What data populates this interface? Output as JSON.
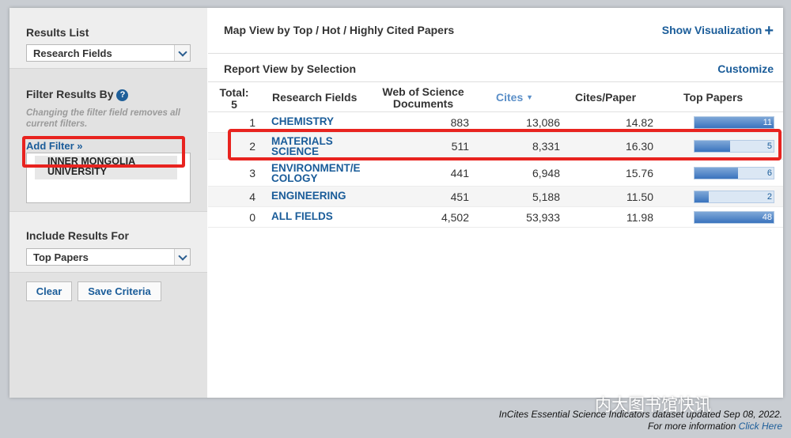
{
  "sidebar": {
    "results_list": {
      "heading": "Results List",
      "selected": "Research Fields"
    },
    "filter": {
      "heading": "Filter Results By",
      "note": "Changing the filter field removes all current filters.",
      "add_filter": "Add Filter »",
      "chip": "INNER MONGOLIA UNIVERSITY"
    },
    "include": {
      "heading": "Include Results For",
      "selected": "Top Papers"
    },
    "buttons": {
      "clear": "Clear",
      "save": "Save Criteria"
    }
  },
  "main": {
    "map_view": "Map View by Top / Hot / Highly Cited Papers",
    "show_visualization": "Show Visualization",
    "report_view": "Report View by Selection",
    "customize": "Customize"
  },
  "table": {
    "headers": {
      "total": "Total:",
      "total_count": "5",
      "field": "Research Fields",
      "docs_line1": "Web of Science",
      "docs_line2": "Documents",
      "cites": "Cites",
      "cpp": "Cites/Paper",
      "top": "Top Papers"
    },
    "rows": [
      {
        "idx": "1",
        "name": "CHEMISTRY",
        "docs": "883",
        "cites": "13,086",
        "cpp": "14.82",
        "top": "11",
        "top_fraction": 1.0
      },
      {
        "idx": "2",
        "name": "MATERIALS SCIENCE",
        "docs": "511",
        "cites": "8,331",
        "cpp": "16.30",
        "top": "5",
        "top_fraction": 0.45
      },
      {
        "idx": "3",
        "name": "ENVIRONMENT/E COLOGY",
        "docs": "441",
        "cites": "6,948",
        "cpp": "15.76",
        "top": "6",
        "top_fraction": 0.55
      },
      {
        "idx": "4",
        "name": "ENGINEERING",
        "docs": "451",
        "cites": "5,188",
        "cpp": "11.50",
        "top": "2",
        "top_fraction": 0.18
      },
      {
        "idx": "0",
        "name": "ALL FIELDS",
        "docs": "4,502",
        "cites": "53,933",
        "cpp": "11.98",
        "top": "48",
        "top_fraction": 1.0
      }
    ]
  },
  "footer": {
    "line1": "InCites Essential Science Indicators dataset updated Sep 08, 2022.",
    "line2": "For more information",
    "link": "Click Here"
  },
  "watermark": "内大图书馆快讯",
  "colors": {
    "accent": "#1a5c99",
    "highlight": "#e8231f",
    "bar_fill": "#3a73bd"
  }
}
